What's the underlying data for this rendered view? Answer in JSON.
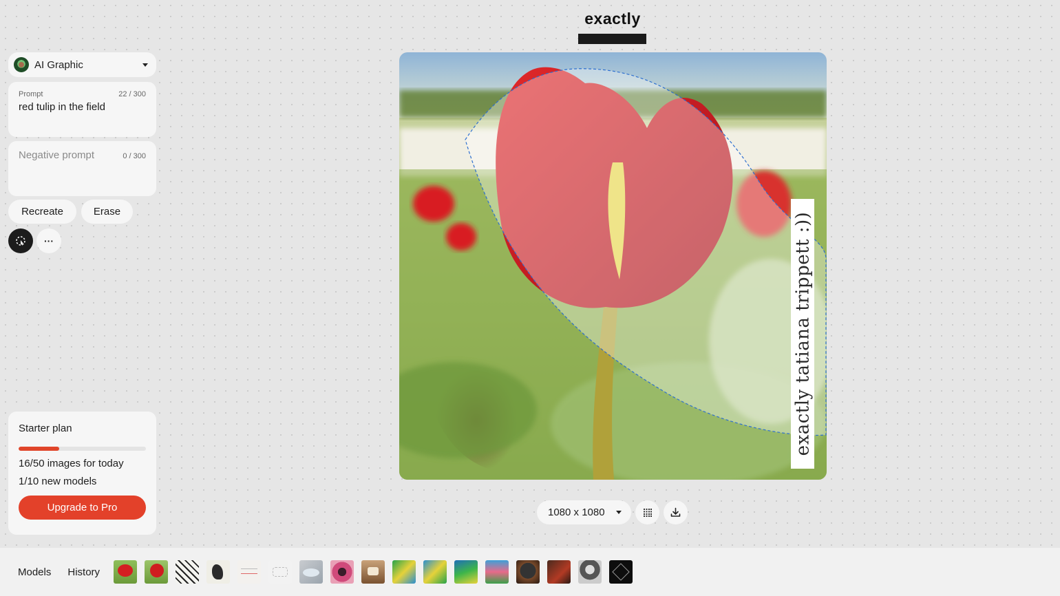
{
  "brand": {
    "name": "exactly"
  },
  "sidebar": {
    "model": {
      "label": "AI Graphic"
    },
    "prompt": {
      "label": "Prompt",
      "count": "22 / 300",
      "value": "red tulip in the field"
    },
    "negative_prompt": {
      "placeholder": "Negative prompt",
      "count": "0 / 300"
    },
    "actions": {
      "recreate": "Recreate",
      "erase": "Erase",
      "more": "···"
    }
  },
  "plan": {
    "title": "Starter plan",
    "progress": 0.32,
    "images_today": "16/50 images for today",
    "new_models": "1/10 new models",
    "upgrade": "Upgrade to Pro"
  },
  "canvas": {
    "watermark": "exactly tatiana trippett :))"
  },
  "toolbar": {
    "size": "1080 x 1080"
  },
  "bottom": {
    "tabs": [
      "Models",
      "History"
    ],
    "thumbnails": [
      "red tulips",
      "red tulips",
      "comic sketch",
      "bird sketch",
      "white sketch",
      "white sketch",
      "blue object",
      "pink swirl",
      "horse painting",
      "green abstract",
      "green abstract",
      "green figure",
      "colorful landscape",
      "dark orb",
      "dark portrait",
      "girl portrait",
      "black pattern"
    ]
  },
  "colors": {
    "accent": "#e3412a",
    "panel": "#f6f6f6",
    "background": "#e6e6e6"
  },
  "icons": [
    "caret-down-icon",
    "select-icon",
    "grid-icon",
    "download-icon"
  ]
}
